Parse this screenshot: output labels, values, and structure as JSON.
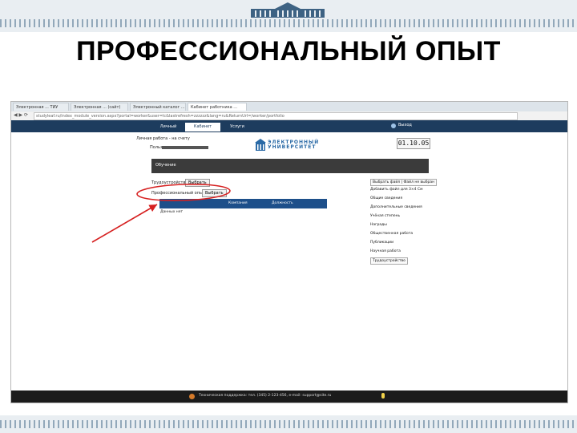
{
  "slide": {
    "title": "ПРОФЕССИОНАЛЬНЫЙ ОПЫТ"
  },
  "browser": {
    "tabs": [
      "Электронная ... ТИУ",
      "Электронная ... (сайт)",
      "Электронный каталог ...",
      "Кабинет работника ..."
    ],
    "url": "studyleaf.ru/index_module_version.aspx?portal=worker&user=lc&lastrefresh=zzzzzz&lang=ru&ReturnUrl=/worker/portfolio"
  },
  "app": {
    "nav": [
      "Личный кабинет",
      "Кабинет",
      "Услуги"
    ],
    "exit_label": "Выход",
    "status_text": "Личная работа - на счету",
    "user_prefix": "Пользователь",
    "logo_line1": "ЭЛЕКТРОННЫЙ",
    "logo_line2": "УНИВЕРСИТЕТ",
    "date_text": "01.10.05",
    "section_title": "Обучение",
    "trud_label": "Трудоустройство",
    "trud_button": "Выбрать",
    "prof_label": "Профессиональный опыт",
    "prof_button": "Выбрать",
    "table_headers": [
      "",
      "Компания",
      "Должность"
    ],
    "table_cell": "Данных нет",
    "side_menu": [
      "Выбрать файл | Файл не выбран",
      "Добавить файл для 3×4 См",
      "Общие сведения",
      "Дополнительные сведения",
      "Учёная степень",
      "Награды",
      "Общественная работа",
      "Публикации",
      "Научная работа",
      "Трудоустройство"
    ]
  },
  "footer": {
    "text": "Техническая поддержка: тел. (345) 2-123-456, e-mail: support@site.ru"
  },
  "colors": {
    "annotation": "#d62020",
    "nav_bar": "#1d3c5e",
    "table_header": "#1d4f8a"
  }
}
